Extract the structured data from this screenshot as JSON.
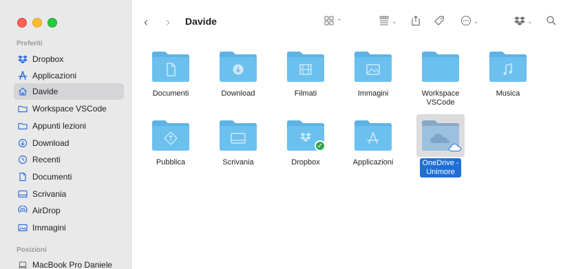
{
  "window": {
    "title": "Davide"
  },
  "sidebar": {
    "sections": [
      {
        "title": "Preferiti",
        "items": [
          {
            "label": "Dropbox",
            "icon": "dropbox-icon"
          },
          {
            "label": "Applicazioni",
            "icon": "applications-icon"
          },
          {
            "label": "Davide",
            "icon": "home-icon",
            "active": true
          },
          {
            "label": "Workspace VSCode",
            "icon": "folder-icon"
          },
          {
            "label": "Appunti lezioni",
            "icon": "folder-icon"
          },
          {
            "label": "Download",
            "icon": "download-icon"
          },
          {
            "label": "Recenti",
            "icon": "clock-icon"
          },
          {
            "label": "Documenti",
            "icon": "document-icon"
          },
          {
            "label": "Scrivania",
            "icon": "desktop-icon"
          },
          {
            "label": "AirDrop",
            "icon": "airdrop-icon"
          },
          {
            "label": "Immagini",
            "icon": "photos-icon"
          }
        ]
      },
      {
        "title": "Posizioni",
        "items": [
          {
            "label": "MacBook Pro Daniele",
            "icon": "laptop-icon"
          }
        ]
      }
    ]
  },
  "toolbar": {
    "back_icon": "chevron-left-icon",
    "forward_icon": "chevron-right-icon",
    "view_icon": "grid-view-icon",
    "group_icon": "group-icon",
    "share_icon": "share-icon",
    "tag_icon": "tag-icon",
    "more_icon": "more-icon",
    "dropbox_icon": "dropbox-icon",
    "search_icon": "search-icon"
  },
  "files": [
    {
      "label": "Documenti",
      "glyph": "document"
    },
    {
      "label": "Download",
      "glyph": "download"
    },
    {
      "label": "Filmati",
      "glyph": "film"
    },
    {
      "label": "Immagini",
      "glyph": "image"
    },
    {
      "label": "Workspace\nVSCode",
      "label_line1": "Workspace",
      "label_line2": "VSCode",
      "glyph": "none"
    },
    {
      "label": "Musica",
      "glyph": "music"
    },
    {
      "label": "Pubblica",
      "glyph": "public"
    },
    {
      "label": "Scrivania",
      "glyph": "desktop"
    },
    {
      "label": "Dropbox",
      "glyph": "dropbox",
      "badge": "check"
    },
    {
      "label": "Applicazioni",
      "glyph": "apps"
    },
    {
      "label_line1": "OneDrive -",
      "label_line2": "Unimore",
      "glyph": "cloud",
      "selected": true
    }
  ],
  "colors": {
    "folder": "#6cc0ee",
    "folder_tab": "#5eb3e5",
    "accent": "#1f6fd6",
    "sidebar_bg": "#e9e9ea"
  }
}
